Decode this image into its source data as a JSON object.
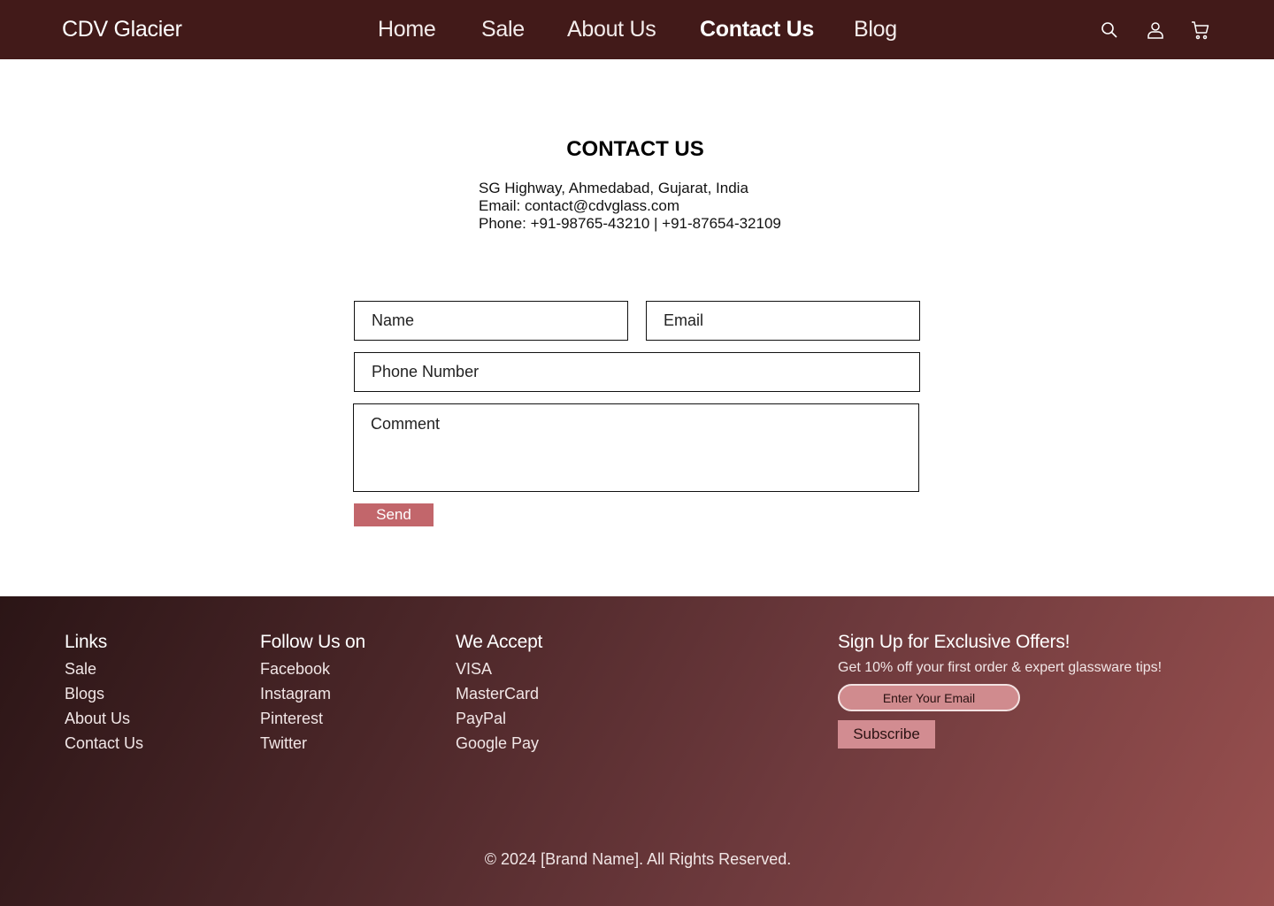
{
  "header": {
    "brand": "CDV Glacier",
    "nav": [
      {
        "label": "Home",
        "active": false
      },
      {
        "label": "Sale",
        "active": false
      },
      {
        "label": "About Us",
        "active": false
      },
      {
        "label": "Contact Us",
        "active": true
      },
      {
        "label": "Blog",
        "active": false
      }
    ],
    "icons": [
      "search-icon",
      "user-icon",
      "cart-icon"
    ],
    "background_color": "#421a19"
  },
  "contact": {
    "title": "CONTACT US",
    "address": "SG Highway, Ahmedabad, Gujarat, India",
    "email": "Email: contact@cdvglass.com",
    "phone": "Phone: +91-98765-43210 | +91-87654-32109"
  },
  "form": {
    "name_placeholder": "Name",
    "email_placeholder": "Email",
    "phone_placeholder": "Phone Number",
    "comment_placeholder": "Comment",
    "send_label": "Send",
    "send_color": "#c2666b"
  },
  "footer": {
    "links": {
      "title": "Links",
      "items": [
        "Sale",
        "Blogs",
        "About Us",
        "Contact Us"
      ]
    },
    "follow": {
      "title": "Follow Us on",
      "items": [
        "Facebook",
        "Instagram",
        "Pinterest",
        "Twitter"
      ]
    },
    "accept": {
      "title": "We Accept",
      "items": [
        "VISA",
        "MasterCard",
        "PayPal",
        "Google Pay"
      ]
    },
    "signup": {
      "title": "Sign Up for Exclusive Offers!",
      "text": "Get 10% off your first order & expert glassware tips!",
      "input_placeholder": "Enter Your Email",
      "button_label": "Subscribe"
    },
    "copyright": "© 2024 [Brand Name]. All Rights Reserved."
  }
}
